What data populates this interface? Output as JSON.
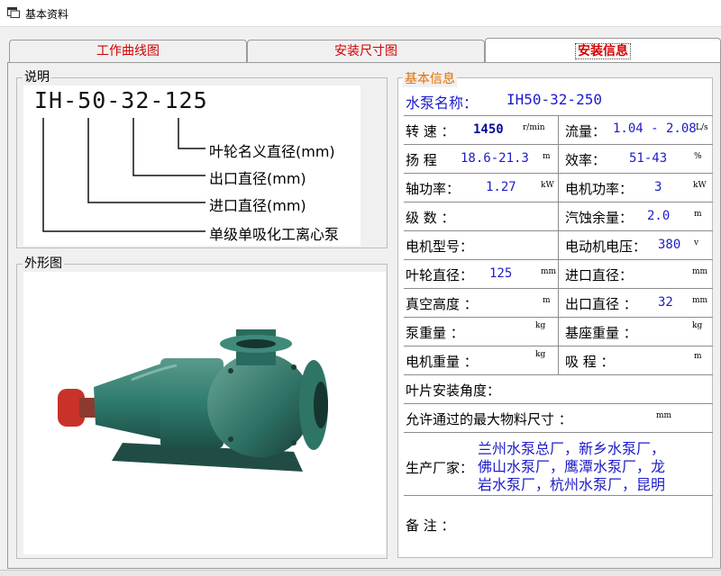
{
  "window": {
    "title": "基本资料"
  },
  "tabs": [
    {
      "label": "工作曲线图"
    },
    {
      "label": "安装尺寸图"
    },
    {
      "label": "安装信息"
    }
  ],
  "explain": {
    "legend": "说明",
    "model_code": "IH-50-32-125",
    "notes": [
      "叶轮名义直径(mm)",
      "出口直径(mm)",
      "进口直径(mm)",
      "单级单吸化工离心泵"
    ]
  },
  "appearance": {
    "legend": "外形图"
  },
  "info": {
    "legend": "基本信息",
    "pump_name_label": "水泵名称：",
    "pump_name_value": "IH50-32-250",
    "rows": [
      {
        "l_label": "转 速 ：",
        "l_value": "1450",
        "l_unit": "r/min",
        "r_label": "流量：",
        "r_value": "1.04 - 2.08",
        "r_unit": "L/s"
      },
      {
        "l_label": "扬 程",
        "l_value": "18.6-21.3",
        "l_unit": "m",
        "r_label": "效率：",
        "r_value": "51-43",
        "r_unit": "%"
      },
      {
        "l_label": "轴功率：",
        "l_value": "1.27",
        "l_unit": "kW",
        "r_label": "电机功率：",
        "r_value": "3",
        "r_unit": "kW"
      },
      {
        "l_label": "级 数 ：",
        "l_value": "",
        "l_unit": "",
        "r_label": "汽蚀余量：",
        "r_value": "2.0",
        "r_unit": "m"
      },
      {
        "l_label": "电机型号：",
        "l_value": "",
        "l_unit": "",
        "r_label": "电动机电压：",
        "r_value": "380",
        "r_unit": "v"
      },
      {
        "l_label": "叶轮直径：",
        "l_value": "125",
        "l_unit": "mm",
        "r_label": "进口直径：",
        "r_value": "",
        "r_unit": "mm"
      },
      {
        "l_label": "真空高度 ：",
        "l_value": "",
        "l_unit": "m",
        "r_label": "出口直径 ：",
        "r_value": "32",
        "r_unit": "mm"
      },
      {
        "l_label": "泵重量 ：",
        "l_value": "",
        "l_unit": "kg",
        "r_label": "基座重量 ：",
        "r_value": "",
        "r_unit": "kg"
      },
      {
        "l_label": "电机重量 ：",
        "l_value": "",
        "l_unit": "kg",
        "r_label": "吸 程 ：",
        "r_value": "",
        "r_unit": "m"
      }
    ],
    "blade_angle_label": "叶片安装角度：",
    "max_material_label": "允许通过的最大物料尺寸 ：",
    "max_material_unit": "mm",
    "manufacturer_label": "生产厂家：",
    "manufacturer_lines": [
      "兰州水泵总厂，新乡水泵厂，",
      "佛山水泵厂，鹰潭水泵厂，龙",
      "岩水泵厂，杭州水泵厂，昆明"
    ],
    "remark_label": "备   注 ："
  },
  "colors": {
    "tab_text": "#d40000",
    "value_text": "#1c1cc8",
    "legend_orange": "#e07000",
    "pump_green": "#2e7c6e",
    "flange_red": "#c83228"
  }
}
